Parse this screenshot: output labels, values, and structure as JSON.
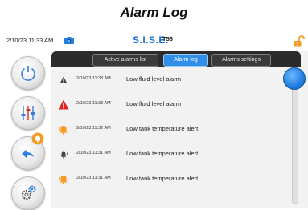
{
  "page": {
    "title": "Alarm Log"
  },
  "topbar": {
    "datetime": "2/10/23 11:33 AM",
    "logo_text": "S.I.S.E.",
    "model": "T56"
  },
  "tabs": [
    {
      "label": "Active alarms list",
      "active": false
    },
    {
      "label": "Alarm log",
      "active": true
    },
    {
      "label": "Alarms settings",
      "active": false
    }
  ],
  "alarms": [
    {
      "icon": "warning-triangle-dark-icon",
      "time": "2/10/23 11:33 AM",
      "message": "Low fluid level alarm"
    },
    {
      "icon": "warning-triangle-red-icon",
      "time": "2/10/23 11:33 AM",
      "message": "Low fluid level alarm"
    },
    {
      "icon": "bell-orange-icon",
      "time": "2/10/23 11:32 AM",
      "message": "Low tank temperature alert"
    },
    {
      "icon": "bell-dark-icon",
      "time": "2/10/23 11:31 AM",
      "message": "Low tank temperature alert"
    },
    {
      "icon": "bell-orange-icon",
      "time": "2/10/23 11:31 AM",
      "message": "Low tank temperature alert"
    }
  ],
  "sidebar": [
    {
      "name": "power-button",
      "icon": "power-icon"
    },
    {
      "name": "adjust-button",
      "icon": "sliders-icon"
    },
    {
      "name": "back-alarms-button",
      "icon": "back-arrow-bell-icon"
    },
    {
      "name": "settings-button",
      "icon": "gears-icon"
    }
  ],
  "colors": {
    "accent": "#2f8ee8",
    "tabbar": "#2b2b2b",
    "alarm_red": "#e02020",
    "alert_orange": "#f59a23"
  }
}
